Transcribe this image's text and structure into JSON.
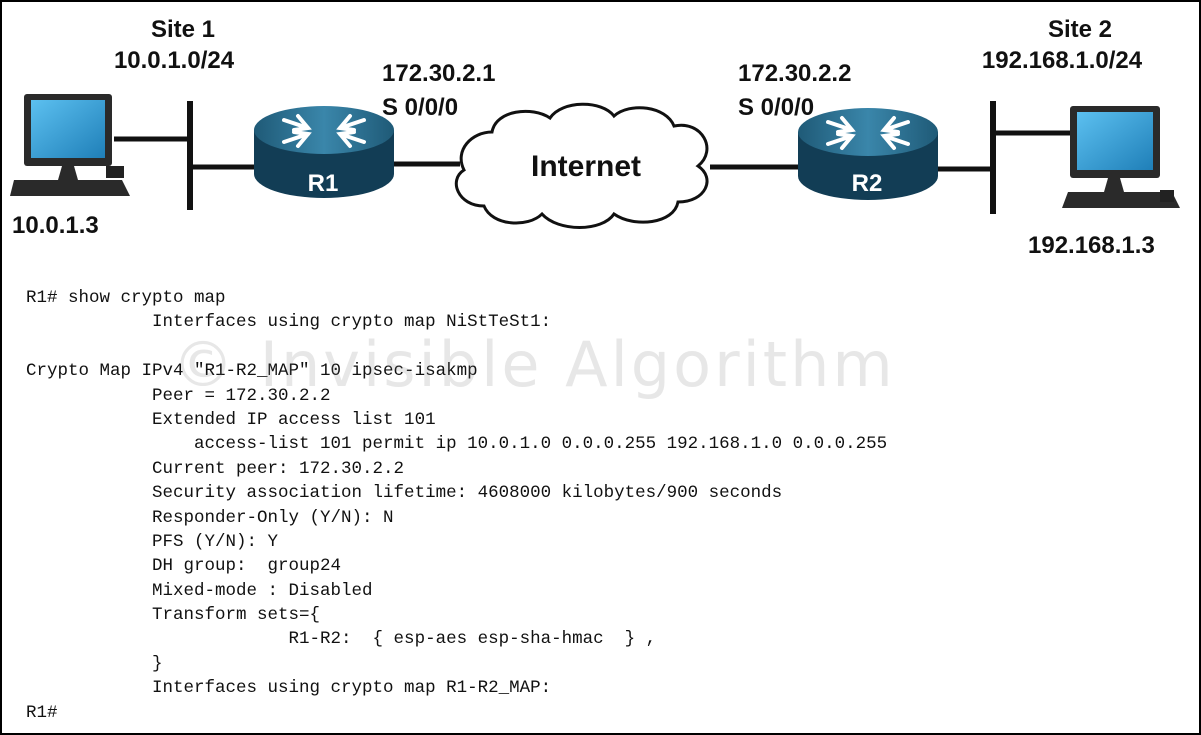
{
  "diagram": {
    "site1": {
      "title": "Site 1",
      "subnet": "10.0.1.0/24",
      "host_ip": "10.0.1.3"
    },
    "site2": {
      "title": "Site 2",
      "subnet": "192.168.1.0/24",
      "host_ip": "192.168.1.3"
    },
    "r1": {
      "name": "R1",
      "ip": "172.30.2.1",
      "interface": "S 0/0/0"
    },
    "r2": {
      "name": "R2",
      "ip": "172.30.2.2",
      "interface": "S 0/0/0"
    },
    "cloud": {
      "label": "Internet"
    },
    "colors": {
      "router_top": "#2b6e8f",
      "router_body": "#123d55",
      "pc_screen": "#3aa0d8"
    }
  },
  "cli": {
    "lines": [
      "R1# show crypto map",
      "            Interfaces using crypto map NiStTeSt1:",
      "",
      "Crypto Map IPv4 \"R1-R2_MAP\" 10 ipsec-isakmp",
      "            Peer = 172.30.2.2",
      "            Extended IP access list 101",
      "                access-list 101 permit ip 10.0.1.0 0.0.0.255 192.168.1.0 0.0.0.255",
      "            Current peer: 172.30.2.2",
      "            Security association lifetime: 4608000 kilobytes/900 seconds",
      "            Responder-Only (Y/N): N",
      "            PFS (Y/N): Y",
      "            DH group:  group24",
      "            Mixed-mode : Disabled",
      "            Transform sets={",
      "                         R1-R2:  { esp-aes esp-sha-hmac  } ,",
      "            }",
      "            Interfaces using crypto map R1-R2_MAP:",
      "R1#"
    ]
  },
  "watermark": {
    "text": "© Invisible Algorithm"
  }
}
